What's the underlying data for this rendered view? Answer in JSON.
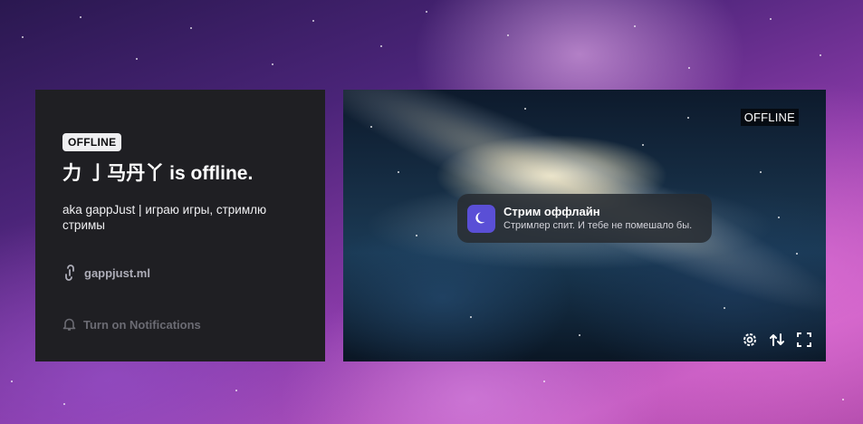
{
  "channel": {
    "status_badge": "OFFLINE",
    "name": "力 亅马丹丫",
    "offline_suffix": " is offline.",
    "bio": "aka gappJust | играю игры, стримлю стримы",
    "link_text": "gappjust.ml",
    "notifications_label": "Turn on Notifications"
  },
  "player": {
    "offline_tag": "OFFLINE",
    "toast": {
      "title": "Стрим оффлайн",
      "subtitle": "Стримлер спит. И тебе не помешало бы.",
      "icon": "moon-icon"
    },
    "controls": [
      "gear-icon",
      "swap-icon",
      "fullscreen-icon"
    ]
  },
  "colors": {
    "panel_bg": "#1f1f23",
    "toast_icon_bg": "#5a4fd6"
  }
}
